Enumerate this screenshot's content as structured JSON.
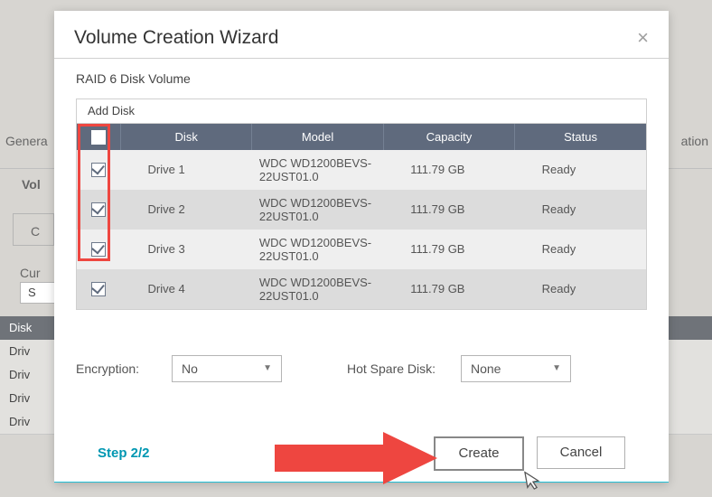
{
  "modal": {
    "title": "Volume Creation Wizard",
    "subtitle": "RAID 6 Disk Volume",
    "add_disk_label": "Add Disk",
    "columns": {
      "disk": "Disk",
      "model": "Model",
      "capacity": "Capacity",
      "status": "Status"
    },
    "rows": [
      {
        "disk": "Drive 1",
        "model": "WDC WD1200BEVS-22UST01.0",
        "capacity": "111.79 GB",
        "status": "Ready"
      },
      {
        "disk": "Drive 2",
        "model": "WDC WD1200BEVS-22UST01.0",
        "capacity": "111.79 GB",
        "status": "Ready"
      },
      {
        "disk": "Drive 3",
        "model": "WDC WD1200BEVS-22UST01.0",
        "capacity": "111.79 GB",
        "status": "Ready"
      },
      {
        "disk": "Drive 4",
        "model": "WDC WD1200BEVS-22UST01.0",
        "capacity": "111.79 GB",
        "status": "Ready"
      }
    ],
    "encryption_label": "Encryption:",
    "encryption_value": "No",
    "hotspare_label": "Hot Spare Disk:",
    "hotspare_value": "None",
    "step_label": "Step 2/2",
    "create_label": "Create",
    "cancel_label": "Cancel"
  },
  "bg": {
    "general_label": "Genera",
    "ation_label": "ation",
    "vol_label": "Vol",
    "c_label": "C",
    "cur_label": "Cur",
    "s_label": "S",
    "disk_label": "Disk",
    "drive_label": "Driv"
  }
}
